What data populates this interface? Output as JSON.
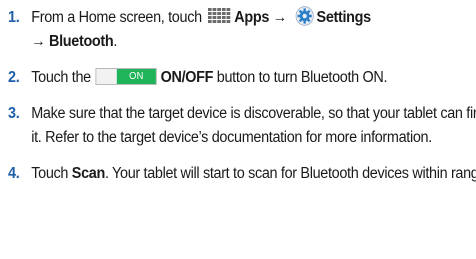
{
  "steps": [
    {
      "number": "1.",
      "text_1": "From a Home screen, touch",
      "apps_label": "Apps",
      "arrow_1": "→",
      "settings_label": "Settings",
      "arrow_2": "→",
      "bluetooth_label": "Bluetooth",
      "period": "."
    },
    {
      "number": "2.",
      "text_1": "Touch the",
      "toggle_on": "ON",
      "onoff_label": "ON/OFF",
      "text_2": "button to turn Bluetooth ON."
    },
    {
      "number": "3.",
      "text": "Make sure that the target device is discoverable, so that your tablet can find it. Refer to the target device’s documentation for more information."
    },
    {
      "number": "4.",
      "text_1": "Touch",
      "scan_label": "Scan",
      "text_2": ". Your tablet will start to scan for Bluetooth devices within range."
    }
  ],
  "icons": {
    "apps": "apps-grid-icon",
    "settings": "settings-gear-icon"
  },
  "colors": {
    "step_number": "#1f5fa8",
    "toggle_on": "#1fb35a",
    "settings_icon": "#2c7fc4"
  }
}
